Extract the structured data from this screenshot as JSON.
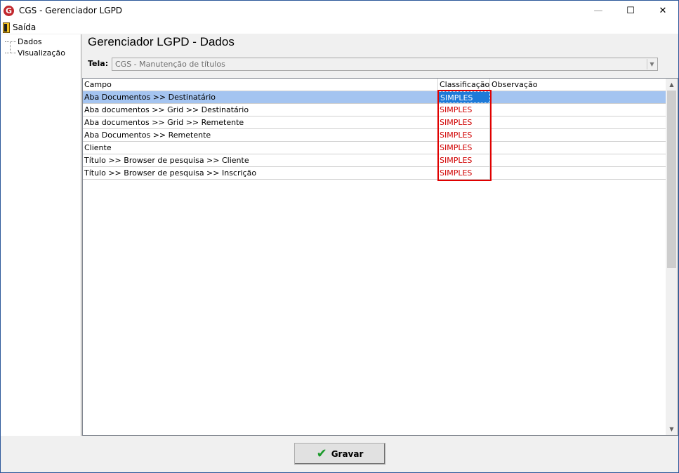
{
  "window": {
    "logo": "G",
    "title": "CGS - Gerenciador LGPD",
    "min_icon": "—",
    "max_icon": "☐",
    "close_icon": "✕"
  },
  "menu": {
    "saida_label": "Saída"
  },
  "sidebar": {
    "items": [
      {
        "label": "Dados"
      },
      {
        "label": "Visualização"
      }
    ]
  },
  "page": {
    "title": "Gerenciador LGPD - Dados",
    "tela_label": "Tela:",
    "tela_value": "CGS - Manutenção de títulos",
    "tela_arrow": "▼"
  },
  "grid": {
    "headers": {
      "campo": "Campo",
      "classificacao": "Classificação",
      "observacao": "Observação"
    },
    "rows": [
      {
        "campo": "Aba Documentos >> Destinatário",
        "classificacao": "SIMPLES",
        "observacao": ""
      },
      {
        "campo": "Aba documentos >> Grid  >> Destinatário",
        "classificacao": "SIMPLES",
        "observacao": ""
      },
      {
        "campo": "Aba documentos >> Grid  >> Remetente",
        "classificacao": "SIMPLES",
        "observacao": ""
      },
      {
        "campo": "Aba Documentos >> Remetente",
        "classificacao": "SIMPLES",
        "observacao": ""
      },
      {
        "campo": "Cliente",
        "classificacao": "SIMPLES",
        "observacao": ""
      },
      {
        "campo": "Título >> Browser de pesquisa >> Cliente",
        "classificacao": "SIMPLES",
        "observacao": ""
      },
      {
        "campo": "Título >> Browser de pesquisa >> Inscrição",
        "classificacao": "SIMPLES",
        "observacao": ""
      }
    ],
    "selected_row": 0,
    "scroll_up": "▲",
    "scroll_down": "▼"
  },
  "footer": {
    "gravar_label": "Gravar",
    "gravar_icon": "✔"
  },
  "colors": {
    "classification": "#d00000",
    "selection": "#a4c4f0",
    "highlight_box": "#e00000",
    "check": "#1a9a2a"
  }
}
